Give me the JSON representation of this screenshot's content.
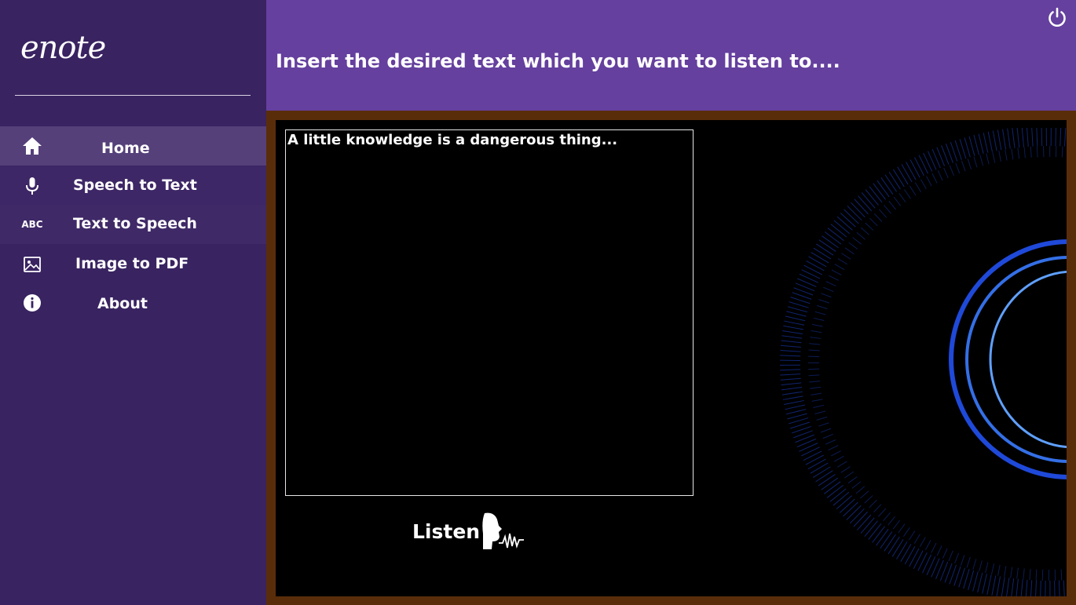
{
  "app": {
    "logo": "enote"
  },
  "sidebar": {
    "items": [
      {
        "label": "Home",
        "icon": "home-icon"
      },
      {
        "label": "Speech to Text",
        "icon": "microphone-icon"
      },
      {
        "label": "Text to Speech",
        "icon": "abc-icon",
        "icon_text": "ABC"
      },
      {
        "label": "Image to PDF",
        "icon": "image-icon"
      },
      {
        "label": "About",
        "icon": "info-icon"
      }
    ]
  },
  "header": {
    "title": "Insert the desired text which you want to listen to....",
    "power_icon": "power-icon"
  },
  "main": {
    "text_value": "A little knowledge is a dangerous thing...",
    "listen_label": "Listen",
    "listen_icon": "speaking-head-icon"
  },
  "colors": {
    "sidebar": "#392361",
    "sidebar_active": "#55407a",
    "header": "#65409e",
    "frame": "#5a2d0a",
    "panel": "#000000",
    "orb": "#1f5cff"
  }
}
